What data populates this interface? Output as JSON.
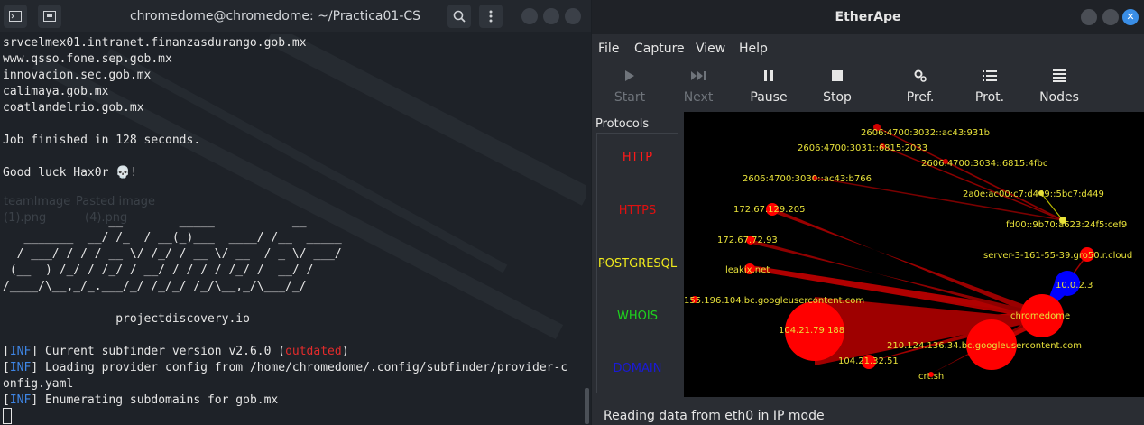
{
  "terminal": {
    "title": "chromedome@chromedome: ~/Practica01-CS",
    "icons": [
      "terminal-icon",
      "new-tab-icon",
      "search-icon",
      "menu-icon"
    ],
    "lines": {
      "l1": "srvcelmex01.intranet.finanzasdurango.gob.mx",
      "l2": "www.qsso.fone.sep.gob.mx",
      "l3": "innovacion.sec.gob.mx",
      "l4": "calimaya.gob.mx",
      "l5": "coatlandelrio.gob.mx",
      "job": "Job finished in 128 seconds.",
      "luck": "Good luck Hax0r 💀!",
      "banner1": "               __        _____           __",
      "banner2": "   _______  __/ /_  / __(_)___  ____/ /__  _____",
      "banner3": "  / ___/ / / / __ \\/ /_/ / __ \\/ __  / _ \\/ ___/",
      "banner4": " (__  ) /_/ / /_/ / __/ / / / / /_/ /  __/ /",
      "banner5": "/____/\\__,_/_.___/_/ /_/_/ /_/\\__,_/\\___/_/",
      "brand": "                projectdiscovery.io",
      "inf_tag": "INF",
      "inf1_pre": " Current subfinder version v2.6.0 (",
      "inf1_out": "outdated",
      "inf1_post": ")",
      "inf2": " Loading provider config from /home/chromedome/.config/subfinder/provider-c",
      "inf2b": "onfig.yaml",
      "inf3": " Enumerating subdomains for gob.mx"
    },
    "desktop_ghost": [
      "teamlmage",
      "Pasted image",
      "(1).png",
      "(4).png"
    ]
  },
  "etherape": {
    "title": "EtherApe",
    "menu": [
      "File",
      "Capture",
      "View",
      "Help"
    ],
    "toolbar": {
      "start": "Start",
      "next": "Next",
      "pause": "Pause",
      "stop": "Stop",
      "pref": "Pref.",
      "prot": "Prot.",
      "nodes": "Nodes"
    },
    "protocols_title": "Protocols",
    "protocols": [
      {
        "name": "HTTP",
        "color": "#ff1a1a"
      },
      {
        "name": "HTTPS",
        "color": "#e01010"
      },
      {
        "name": "POSTGRESQL",
        "color": "#f0ea1c"
      },
      {
        "name": "WHOIS",
        "color": "#1ed31e"
      },
      {
        "name": "DOMAIN",
        "color": "#1a1ad8"
      }
    ],
    "nodes": [
      "2606:4700:3032::ac43:931b",
      "2606:4700:3031::6815:2033",
      "2606:4700:3034::6815:4fbc",
      "2606:4700:3030::ac43:b766",
      "2a0e:ac00:c7:d449::5bc7:d449",
      "172.67.129.205",
      "fd00::9b70:a623:24f5:cef9",
      "172.67.72.93",
      "server-3-161-55-39.gro50.r.cloud",
      "leakix.net",
      "10.0.2.3",
      "155.196.104.bc.googleusercontent.com",
      "chromedome",
      "104.21.79.188",
      "210.124.136.34.bc.googleusercontent.com",
      "104.21.32.51",
      "crt.sh"
    ],
    "status": "Reading data from eth0 in IP mode"
  }
}
